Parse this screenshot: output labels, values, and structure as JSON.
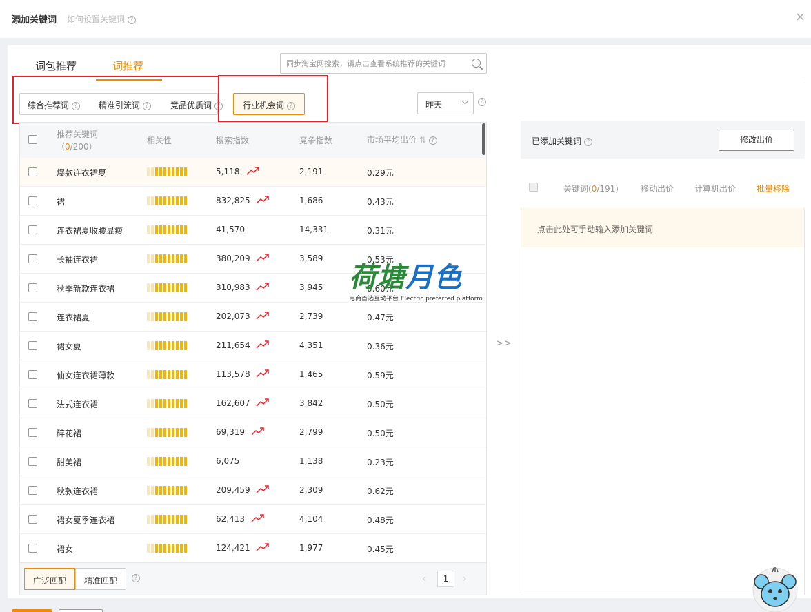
{
  "dialog": {
    "title": "添加关键词",
    "help": "如何设置关键词",
    "close": "×"
  },
  "tabs": [
    {
      "label": "词包推荐"
    },
    {
      "label": "词推荐"
    }
  ],
  "search": {
    "placeholder": "同步淘宝网搜索，请点击查看系统推荐的关键词"
  },
  "filters": [
    {
      "label": "综合推荐词"
    },
    {
      "label": "精准引流词"
    },
    {
      "label": "竞品优质词"
    },
    {
      "label": "行业机会词"
    }
  ],
  "date_select": {
    "value": "昨天"
  },
  "table": {
    "headers": {
      "keyword": "推荐关键词",
      "count_open": "（",
      "count_value": "0",
      "count_total": "/200）",
      "relevance": "相关性",
      "search_index": "搜索指数",
      "competition_index": "竞争指数",
      "avg_bid": "市场平均出价"
    },
    "rows": [
      {
        "keyword": "爆款连衣裙夏",
        "relevance": 0.8,
        "search": "5,118",
        "trend": true,
        "competition": "2,191",
        "bid": "0.29元"
      },
      {
        "keyword": "裙",
        "relevance": 0.8,
        "search": "832,825",
        "trend": true,
        "competition": "1,686",
        "bid": "0.43元"
      },
      {
        "keyword": "连衣裙夏收腰显瘦",
        "relevance": 0.8,
        "search": "41,570",
        "trend": false,
        "competition": "14,331",
        "bid": "0.31元"
      },
      {
        "keyword": "长袖连衣裙",
        "relevance": 0.8,
        "search": "380,209",
        "trend": true,
        "competition": "3,589",
        "bid": "0.53元"
      },
      {
        "keyword": "秋季新款连衣裙",
        "relevance": 0.8,
        "search": "310,983",
        "trend": true,
        "competition": "3,945",
        "bid": "0.60元"
      },
      {
        "keyword": "连衣裙夏",
        "relevance": 0.8,
        "search": "202,073",
        "trend": true,
        "competition": "2,739",
        "bid": "0.47元"
      },
      {
        "keyword": "裙女夏",
        "relevance": 0.8,
        "search": "211,654",
        "trend": true,
        "competition": "4,351",
        "bid": "0.36元"
      },
      {
        "keyword": "仙女连衣裙薄款",
        "relevance": 0.8,
        "search": "113,578",
        "trend": true,
        "competition": "1,465",
        "bid": "0.59元"
      },
      {
        "keyword": "法式连衣裙",
        "relevance": 0.8,
        "search": "162,607",
        "trend": true,
        "competition": "3,842",
        "bid": "0.50元"
      },
      {
        "keyword": "碎花裙",
        "relevance": 0.8,
        "search": "69,319",
        "trend": true,
        "competition": "2,799",
        "bid": "0.50元"
      },
      {
        "keyword": "甜美裙",
        "relevance": 0.8,
        "search": "6,075",
        "trend": false,
        "competition": "1,138",
        "bid": "0.23元"
      },
      {
        "keyword": "秋款连衣裙",
        "relevance": 0.8,
        "search": "209,459",
        "trend": true,
        "competition": "2,309",
        "bid": "0.62元"
      },
      {
        "keyword": "裙女夏季连衣裙",
        "relevance": 0.8,
        "search": "62,413",
        "trend": true,
        "competition": "4,104",
        "bid": "0.48元"
      },
      {
        "keyword": "裙女",
        "relevance": 0.8,
        "search": "124,421",
        "trend": true,
        "competition": "1,977",
        "bid": "0.45元"
      }
    ]
  },
  "footer": {
    "broad_match": "广泛匹配",
    "exact_match": "精准匹配",
    "page": "1"
  },
  "transfer_arrow": ">>",
  "added": {
    "title": "已添加关键词",
    "modify_button": "修改出价",
    "headers": {
      "keyword": "关键词(",
      "count_value": "0",
      "count_total": "/191)",
      "mobile_bid": "移动出价",
      "pc_bid": "计算机出价",
      "batch_remove": "批量移除"
    },
    "manual_input": "点击此处可手动输入添加关键词"
  },
  "watermark": {
    "brand": "荷塘月色",
    "tagline": "电商首选互动平台 Electric preferred platform"
  },
  "colors": {
    "accent": "#f08a00",
    "highlight_red": "#e8202a",
    "trend_red": "#e8202a",
    "bar_on": "#f5b400",
    "bar_off": "#f6e3a8"
  }
}
